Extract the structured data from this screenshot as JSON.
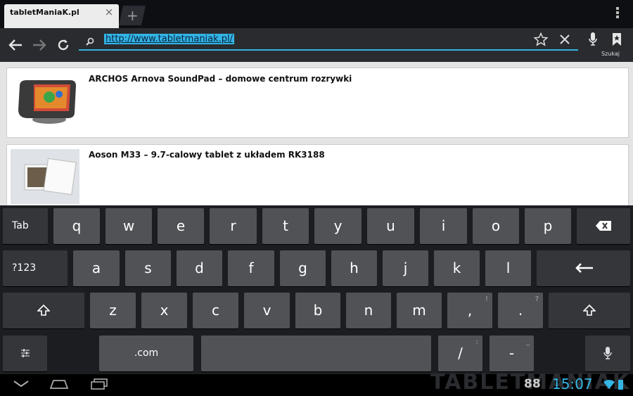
{
  "browser": {
    "tab_title": "tabletManiaK.pl",
    "tab_close": "×",
    "new_tab": "+",
    "url": "http://www.tabletmaniak.pl/",
    "search_hint": "Szukaj"
  },
  "articles": [
    {
      "title": "ARCHOS Arnova SoundPad – domowe centrum rozrywki"
    },
    {
      "title": "Aoson M33 – 9.7-calowy tablet z układem RK3188"
    }
  ],
  "keyboard": {
    "row1": [
      "Tab",
      "q",
      "w",
      "e",
      "r",
      "t",
      "y",
      "u",
      "i",
      "o",
      "p"
    ],
    "row2": [
      "?123",
      "a",
      "s",
      "d",
      "f",
      "g",
      "h",
      "j",
      "k",
      "l"
    ],
    "row3": [
      "z",
      "x",
      "c",
      "v",
      "b",
      "n",
      "m",
      ",",
      "."
    ],
    "row3_hints": [
      "!",
      "?"
    ],
    "row4": [
      ".com",
      "/",
      "-"
    ],
    "row4_hints": [
      ":",
      "_"
    ]
  },
  "status": {
    "watermark": "TABLETMANIAK",
    "count": "88",
    "time": "15:07"
  },
  "colors": {
    "accent": "#33b5e5"
  },
  "icons": [
    "back-icon",
    "forward-icon",
    "refresh-icon",
    "search-icon",
    "star-icon",
    "close-icon",
    "mic-icon",
    "bookmark-icon",
    "menu-icon",
    "backspace-icon",
    "enter-icon",
    "shift-icon",
    "settings-icon",
    "home-icon",
    "recent-apps-icon",
    "wifi-icon",
    "battery-icon"
  ]
}
